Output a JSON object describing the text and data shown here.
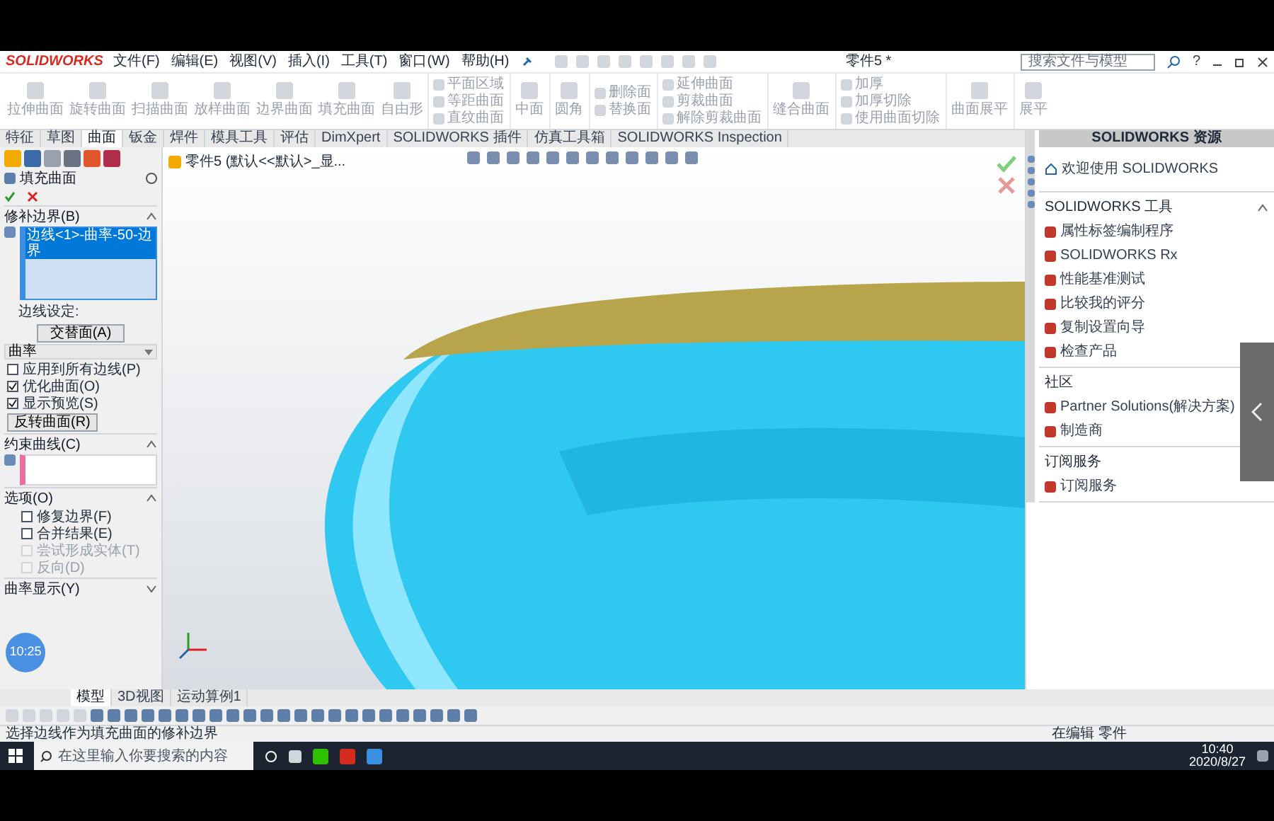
{
  "menubar": {
    "logo": "SOLIDWORKS",
    "menus": [
      "文件(F)",
      "编辑(E)",
      "视图(V)",
      "插入(I)",
      "工具(T)",
      "窗口(W)",
      "帮助(H)"
    ],
    "doc_title": "零件5 *",
    "search": {
      "placeholder": "搜索文件与模型"
    },
    "help": "?"
  },
  "ribbon": {
    "large": [
      "拉伸曲面",
      "旋转曲面",
      "扫描曲面",
      "放样曲面",
      "边界曲面",
      "填充曲面",
      "自由形"
    ],
    "columns": [
      {
        "kind": "small",
        "items": [
          "平面区域",
          "等距曲面",
          "直纹曲面"
        ]
      },
      {
        "kind": "large",
        "items": [
          "中面"
        ]
      },
      {
        "kind": "large",
        "items": [
          "圆角"
        ]
      },
      {
        "kind": "small",
        "items": [
          "删除面",
          "替换面"
        ]
      },
      {
        "kind": "small",
        "items": [
          "延伸曲面",
          "剪裁曲面",
          "解除剪裁曲面"
        ]
      },
      {
        "kind": "large",
        "items": [
          "缝合曲面"
        ]
      },
      {
        "kind": "small",
        "items": [
          "加厚",
          "加厚切除",
          "使用曲面切除"
        ]
      },
      {
        "kind": "large",
        "items": [
          "曲面展平"
        ]
      },
      {
        "kind": "large",
        "items": [
          "展平"
        ]
      }
    ]
  },
  "command_tabs": [
    {
      "label": "特征",
      "selected": false
    },
    {
      "label": "草图",
      "selected": false
    },
    {
      "label": "曲面",
      "selected": true
    },
    {
      "label": "钣金",
      "selected": false
    },
    {
      "label": "焊件",
      "selected": false
    },
    {
      "label": "模具工具",
      "selected": false
    },
    {
      "label": "评估",
      "selected": false
    },
    {
      "label": "DimXpert",
      "selected": false
    },
    {
      "label": "SOLIDWORKS 插件",
      "selected": false
    },
    {
      "label": "仿真工具箱",
      "selected": false
    },
    {
      "label": "SOLIDWORKS Inspection",
      "selected": false
    }
  ],
  "property_manager": {
    "title": "填充曲面",
    "sections": [
      {
        "kind": "boundary",
        "title": "修补边界(B)",
        "expanded": true,
        "list": [
          "边线<1>-曲率-50-边界"
        ],
        "settings_label": "边线设定:",
        "alternate_button": "交替面(A)",
        "dropdown": "曲率",
        "checks": [
          {
            "label": "应用到所有边线(P)",
            "checked": false,
            "disabled": false
          },
          {
            "label": "优化曲面(O)",
            "checked": true,
            "disabled": false
          },
          {
            "label": "显示预览(S)",
            "checked": true,
            "disabled": false
          }
        ],
        "reverse_button": "反转曲面(R)"
      },
      {
        "kind": "curves",
        "title": "约束曲线(C)",
        "expanded": true
      },
      {
        "kind": "options",
        "title": "选项(O)",
        "expanded": true,
        "checks": [
          {
            "label": "修复边界(F)",
            "checked": false,
            "disabled": false
          },
          {
            "label": "合并结果(E)",
            "checked": false,
            "disabled": false
          },
          {
            "label": "尝试形成实体(T)",
            "checked": false,
            "disabled": true
          },
          {
            "label": "反向(D)",
            "checked": false,
            "disabled": true
          }
        ]
      },
      {
        "title": "曲率显示(Y)",
        "expanded": false
      }
    ],
    "recorder_badge": "10:25"
  },
  "viewport": {
    "breadcrumb": "零件5 (默认<<默认>_显..."
  },
  "task_pane": {
    "title": "SOLIDWORKS 资源",
    "welcome": "欢迎使用 SOLIDWORKS",
    "sections": [
      {
        "title": "SOLIDWORKS 工具",
        "expanded": true,
        "items": [
          "属性标签编制程序",
          "SOLIDWORKS Rx",
          "性能基准测试",
          "比较我的评分",
          "复制设置向导",
          "检查产品"
        ]
      },
      {
        "title": "社区",
        "expanded": true,
        "items": [
          "Partner Solutions(解决方案)",
          "制造商"
        ]
      },
      {
        "title": "订阅服务",
        "expanded": true,
        "items": [
          "订阅服务"
        ]
      }
    ]
  },
  "bottom_tabs": [
    {
      "label": "模型",
      "selected": true
    },
    {
      "label": "3D视图",
      "selected": false
    },
    {
      "label": "运动算例1",
      "selected": false
    }
  ],
  "status_bar": {
    "message": "选择边线作为填充曲面的修补边界",
    "mode": "在编辑 零件"
  },
  "taskbar": {
    "search": {
      "placeholder": "在这里输入你要搜索的内容"
    },
    "time": "10:40",
    "date": "2020/8/27"
  }
}
